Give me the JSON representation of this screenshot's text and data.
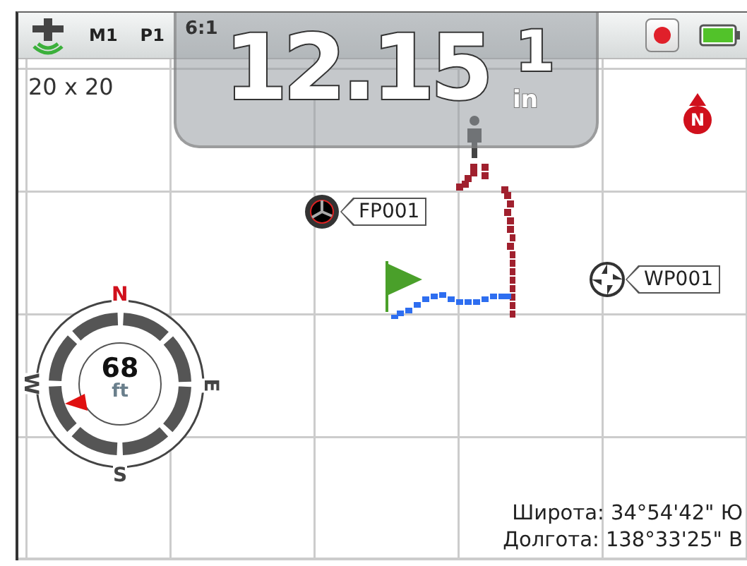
{
  "status_bar": {
    "mode": "M1",
    "profile": "P1",
    "time": "6:1"
  },
  "depth_panel": {
    "value": "12.15",
    "depth": "1",
    "unit": "in"
  },
  "map": {
    "scale": "20 x 20",
    "north": "N",
    "waypoints": [
      {
        "label": "FP001",
        "kind": "find"
      },
      {
        "label": "WP001",
        "kind": "waypoint"
      }
    ],
    "compass": {
      "north": "N",
      "east": "E",
      "south": "S",
      "west": "W",
      "distance": "68",
      "unit": "ft"
    },
    "coordinates": [
      {
        "label": "Широта: 34°54'42\" Ю"
      },
      {
        "label": "Долгота: 138°33'25\" В"
      }
    ]
  }
}
